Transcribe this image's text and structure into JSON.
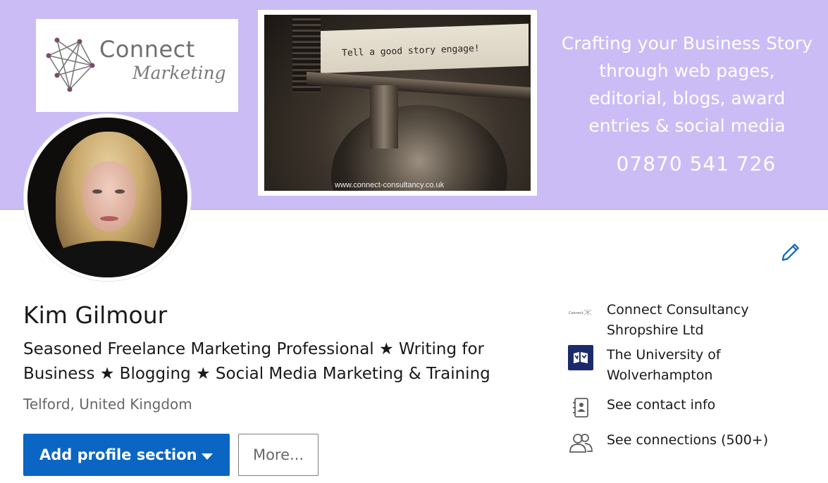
{
  "banner": {
    "logo": {
      "title": "Connect",
      "subtitle": "Marketing"
    },
    "photo": {
      "typed_text": "Tell a good story engage!",
      "url": "www.connect-consultancy.co.uk"
    },
    "tagline": [
      "Crafting your Business Story",
      "through web pages,",
      "editorial, blogs, award",
      "entries & social media"
    ],
    "phone": "07870 541 726",
    "background_color": "#cbbcf6"
  },
  "profile": {
    "name": "Kim Gilmour",
    "headline": "Seasoned Freelance Marketing Professional ★ Writing for Business ★ Blogging ★ Social Media Marketing & Training",
    "location": "Telford, United Kingdom",
    "edit_icon": "pencil-icon"
  },
  "actions": {
    "primary_label": "Add profile section",
    "more_label": "More..."
  },
  "sidebar": {
    "items": [
      {
        "label": "Connect Consultancy Shropshire Ltd",
        "icon": "company-logo-icon",
        "logo_text": "Connect"
      },
      {
        "label": "The University of Wolverhampton",
        "icon": "university-logo-icon"
      },
      {
        "label": "See contact info",
        "icon": "address-book-icon"
      },
      {
        "label": "See connections (500+)",
        "icon": "people-icon"
      }
    ]
  },
  "colors": {
    "accent": "#0a66c2",
    "text": "#191919",
    "muted": "#666666"
  }
}
